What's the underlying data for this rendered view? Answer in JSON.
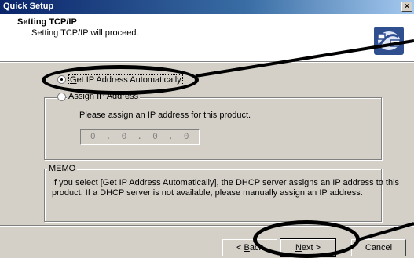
{
  "window": {
    "title": "Quick Setup",
    "close_glyph": "×"
  },
  "header": {
    "title": "Setting TCP/IP",
    "subtitle": "Setting TCP/IP will proceed.",
    "icon": "network-setup-icon"
  },
  "options": {
    "auto_label_underlined": "G",
    "auto_label_rest": "et IP Address Automatically",
    "auto_selected": true,
    "assign_label_underlined": "A",
    "assign_label_rest": "ssign IP Address",
    "assign_selected": false
  },
  "assign_group": {
    "description": "Please assign an IP address for this product.",
    "ip_value": "0  .  0  .  0  .  0"
  },
  "memo": {
    "legend": "MEMO",
    "line1": "If you select [Get IP Address Automatically], the DHCP server assigns an IP address to this",
    "line2": "product. If a DHCP server is not available, please manually assign an IP address."
  },
  "buttons": {
    "back_underlined": "B",
    "back_prefix": "< ",
    "back_rest": "ack",
    "next_underlined": "N",
    "next_rest": "ext >",
    "cancel": "Cancel"
  },
  "colors": {
    "dialog_bg": "#d4d0c8",
    "titlebar_start": "#0a246a",
    "titlebar_end": "#a6caf0",
    "annotation": "#000000"
  }
}
